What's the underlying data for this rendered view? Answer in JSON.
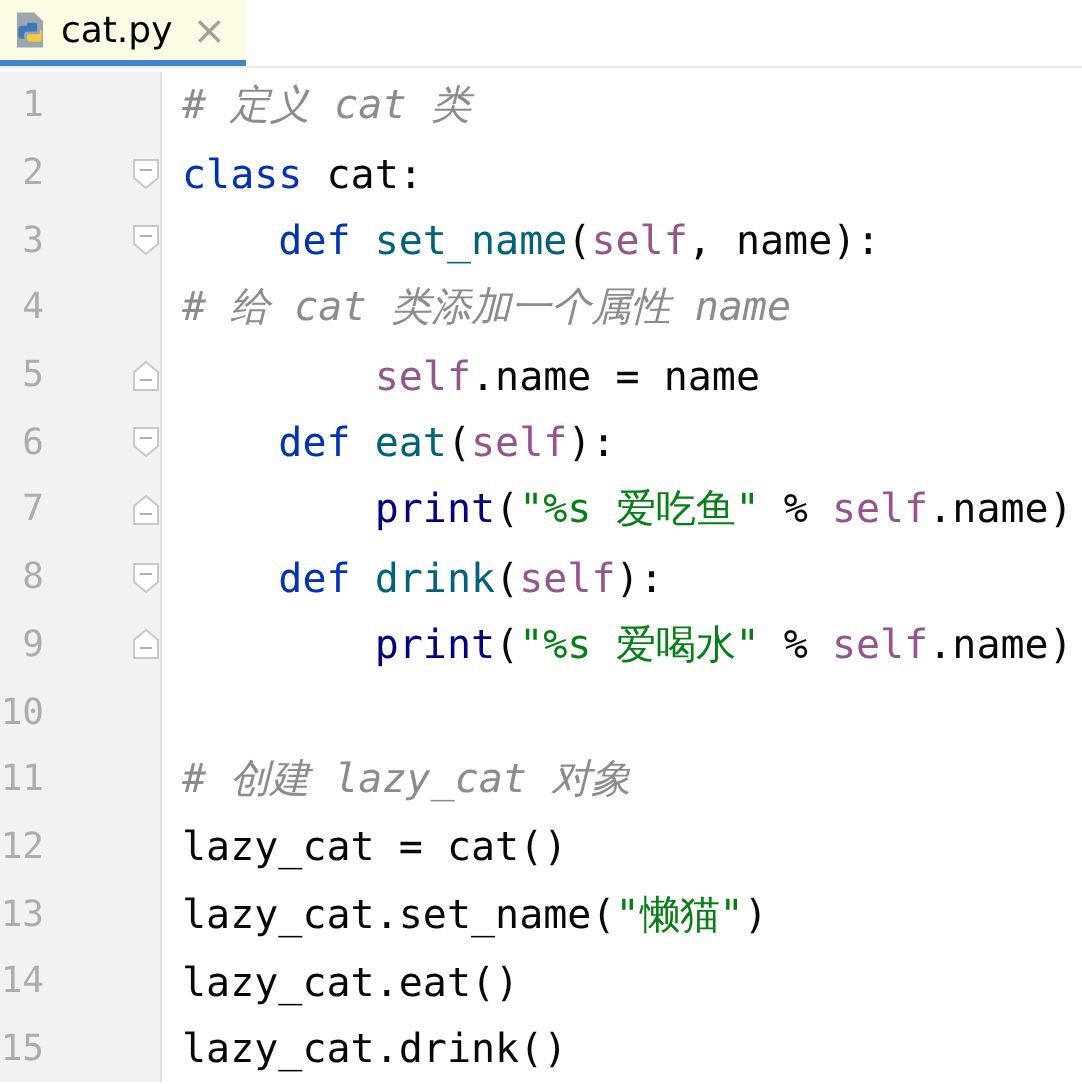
{
  "tabs": [
    {
      "label": "cat.py",
      "close": "×",
      "selected": true
    }
  ],
  "lines": [
    {
      "number": "1",
      "tokens": [
        {
          "kind": "comment",
          "text": "# 定义 cat 类"
        }
      ]
    },
    {
      "number": "2",
      "fold_start": true,
      "tokens": [
        {
          "kind": "keyword",
          "text": "class"
        },
        {
          "kind": "plain",
          "text": " cat:"
        }
      ]
    },
    {
      "number": "3",
      "fold_start": true,
      "tokens": [
        {
          "kind": "keyword",
          "text": "    def"
        },
        {
          "kind": "func",
          "text": " set_name"
        },
        {
          "kind": "plain",
          "text": "("
        },
        {
          "kind": "self",
          "text": "self"
        },
        {
          "kind": "plain",
          "text": ", name):"
        }
      ]
    },
    {
      "number": "4",
      "tokens": [
        {
          "kind": "comment",
          "text": "# 给 cat 类添加一个属性 name"
        }
      ]
    },
    {
      "number": "5",
      "fold_end": true,
      "tokens": [
        {
          "kind": "self",
          "text": "        self"
        },
        {
          "kind": "plain",
          "text": ".name = name"
        }
      ]
    },
    {
      "number": "6",
      "fold_start": true,
      "tokens": [
        {
          "kind": "keyword",
          "text": "    def"
        },
        {
          "kind": "func",
          "text": " eat"
        },
        {
          "kind": "plain",
          "text": "("
        },
        {
          "kind": "self",
          "text": "self"
        },
        {
          "kind": "plain",
          "text": "):"
        }
      ]
    },
    {
      "number": "7",
      "fold_end": true,
      "tokens": [
        {
          "kind": "builtin",
          "text": "        print"
        },
        {
          "kind": "plain",
          "text": "("
        },
        {
          "kind": "string",
          "text": "\"%s 爱吃鱼\""
        },
        {
          "kind": "plain",
          "text": " % "
        },
        {
          "kind": "self",
          "text": "self"
        },
        {
          "kind": "plain",
          "text": ".name)"
        }
      ]
    },
    {
      "number": "8",
      "fold_start": true,
      "tokens": [
        {
          "kind": "keyword",
          "text": "    def"
        },
        {
          "kind": "func",
          "text": " drink"
        },
        {
          "kind": "plain",
          "text": "("
        },
        {
          "kind": "self",
          "text": "self"
        },
        {
          "kind": "plain",
          "text": "):"
        }
      ]
    },
    {
      "number": "9",
      "fold_end": true,
      "tokens": [
        {
          "kind": "builtin",
          "text": "        print"
        },
        {
          "kind": "plain",
          "text": "("
        },
        {
          "kind": "string",
          "text": "\"%s 爱喝水\""
        },
        {
          "kind": "plain",
          "text": " % "
        },
        {
          "kind": "self",
          "text": "self"
        },
        {
          "kind": "plain",
          "text": ".name)"
        }
      ]
    },
    {
      "number": "10"
    },
    {
      "number": "11",
      "tokens": [
        {
          "kind": "comment",
          "text": "# 创建 lazy_cat 对象"
        }
      ]
    },
    {
      "number": "12",
      "tokens": [
        {
          "kind": "plain",
          "text": "lazy_cat = cat()"
        }
      ]
    },
    {
      "number": "13",
      "tokens": [
        {
          "kind": "plain",
          "text": "lazy_cat.set_name("
        },
        {
          "kind": "string",
          "text": "\"懒猫\""
        },
        {
          "kind": "plain",
          "text": ")"
        }
      ]
    },
    {
      "number": "14",
      "tokens": [
        {
          "kind": "plain",
          "text": "lazy_cat.eat()"
        }
      ]
    },
    {
      "number": "15",
      "tokens": [
        {
          "kind": "plain",
          "text": "lazy_cat.drink()"
        }
      ]
    }
  ]
}
